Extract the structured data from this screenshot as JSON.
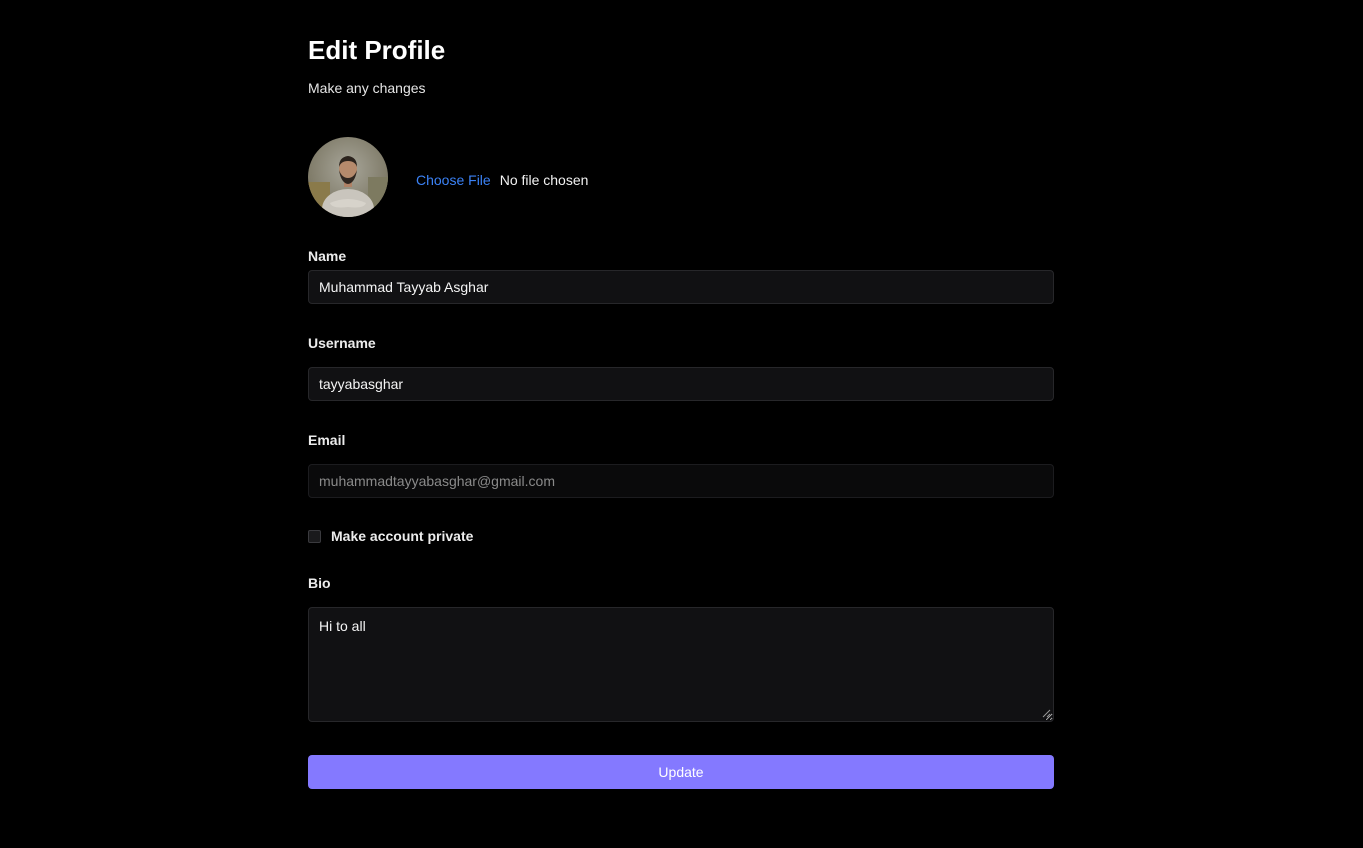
{
  "header": {
    "title": "Edit Profile",
    "subtitle": "Make any changes"
  },
  "avatar": {
    "icon": "profile-photo"
  },
  "file_picker": {
    "button_label": "Choose File",
    "status": "No file chosen"
  },
  "form": {
    "name": {
      "label": "Name",
      "value": "Muhammad Tayyab Asghar"
    },
    "username": {
      "label": "Username",
      "value": "tayyabasghar"
    },
    "email": {
      "label": "Email",
      "value": "muhammadtayyabasghar@gmail.com",
      "disabled": true
    },
    "private_account": {
      "label": "Make account private",
      "checked": false
    },
    "bio": {
      "label": "Bio",
      "value": "Hi to all"
    },
    "submit_label": "Update"
  },
  "colors": {
    "background": "#000000",
    "accent": "#8479ff",
    "link": "#3b82f6",
    "input_background": "#111113"
  }
}
